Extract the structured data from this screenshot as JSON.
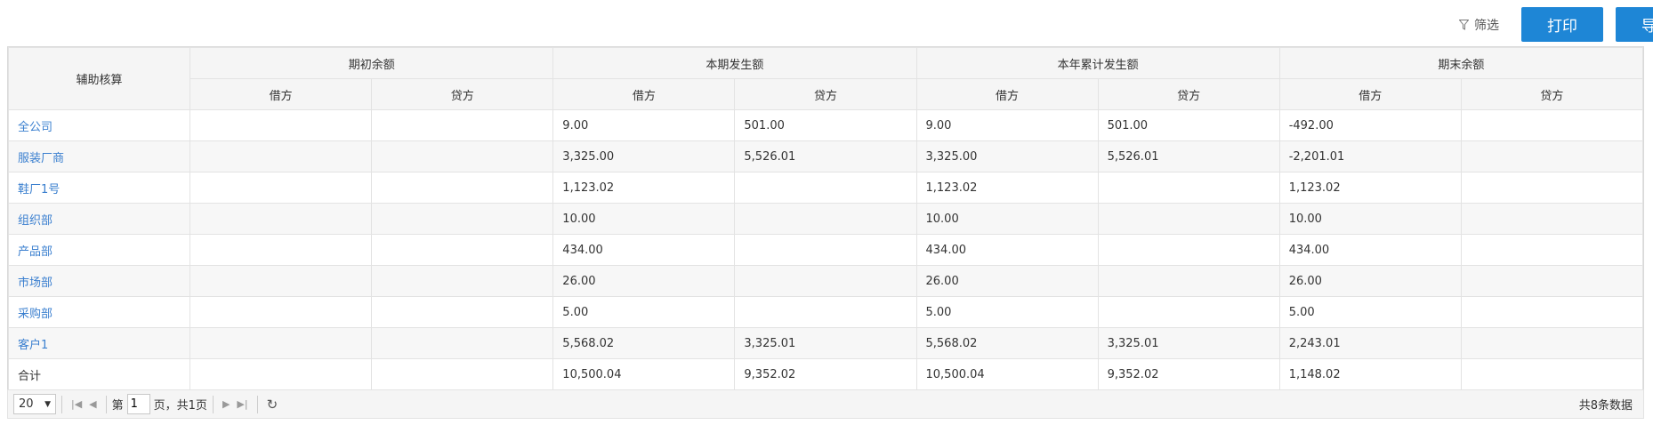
{
  "toolbar": {
    "filter_label": "筛选",
    "print_label": "打印",
    "export_label": "导出",
    "accent_color": "#1e86d6"
  },
  "table": {
    "first_column_header": "辅助核算",
    "group_headers": [
      "期初余额",
      "本期发生额",
      "本年累计发生额",
      "期末余额"
    ],
    "sub_headers": [
      "借方",
      "贷方",
      "借方",
      "贷方",
      "借方",
      "贷方",
      "借方",
      "贷方"
    ],
    "rows": [
      {
        "name": "全公司",
        "cells": [
          "",
          "",
          "9.00",
          "501.00",
          "9.00",
          "501.00",
          "-492.00",
          ""
        ]
      },
      {
        "name": "服装厂商",
        "cells": [
          "",
          "",
          "3,325.00",
          "5,526.01",
          "3,325.00",
          "5,526.01",
          "-2,201.01",
          ""
        ]
      },
      {
        "name": "鞋厂1号",
        "cells": [
          "",
          "",
          "1,123.02",
          "",
          "1,123.02",
          "",
          "1,123.02",
          ""
        ]
      },
      {
        "name": "组织部",
        "cells": [
          "",
          "",
          "10.00",
          "",
          "10.00",
          "",
          "10.00",
          ""
        ]
      },
      {
        "name": "产品部",
        "cells": [
          "",
          "",
          "434.00",
          "",
          "434.00",
          "",
          "434.00",
          ""
        ]
      },
      {
        "name": "市场部",
        "cells": [
          "",
          "",
          "26.00",
          "",
          "26.00",
          "",
          "26.00",
          ""
        ]
      },
      {
        "name": "采购部",
        "cells": [
          "",
          "",
          "5.00",
          "",
          "5.00",
          "",
          "5.00",
          ""
        ]
      },
      {
        "name": "客户1",
        "cells": [
          "",
          "",
          "5,568.02",
          "3,325.01",
          "5,568.02",
          "3,325.01",
          "2,243.01",
          ""
        ]
      }
    ],
    "total_row": {
      "name": "合计",
      "cells": [
        "",
        "",
        "10,500.04",
        "9,352.02",
        "10,500.04",
        "9,352.02",
        "1,148.02",
        ""
      ]
    }
  },
  "pager": {
    "page_size": "20",
    "page_prefix": "第",
    "current_page": "1",
    "page_suffix": "页，共1页",
    "total_records": "共8条数据"
  }
}
